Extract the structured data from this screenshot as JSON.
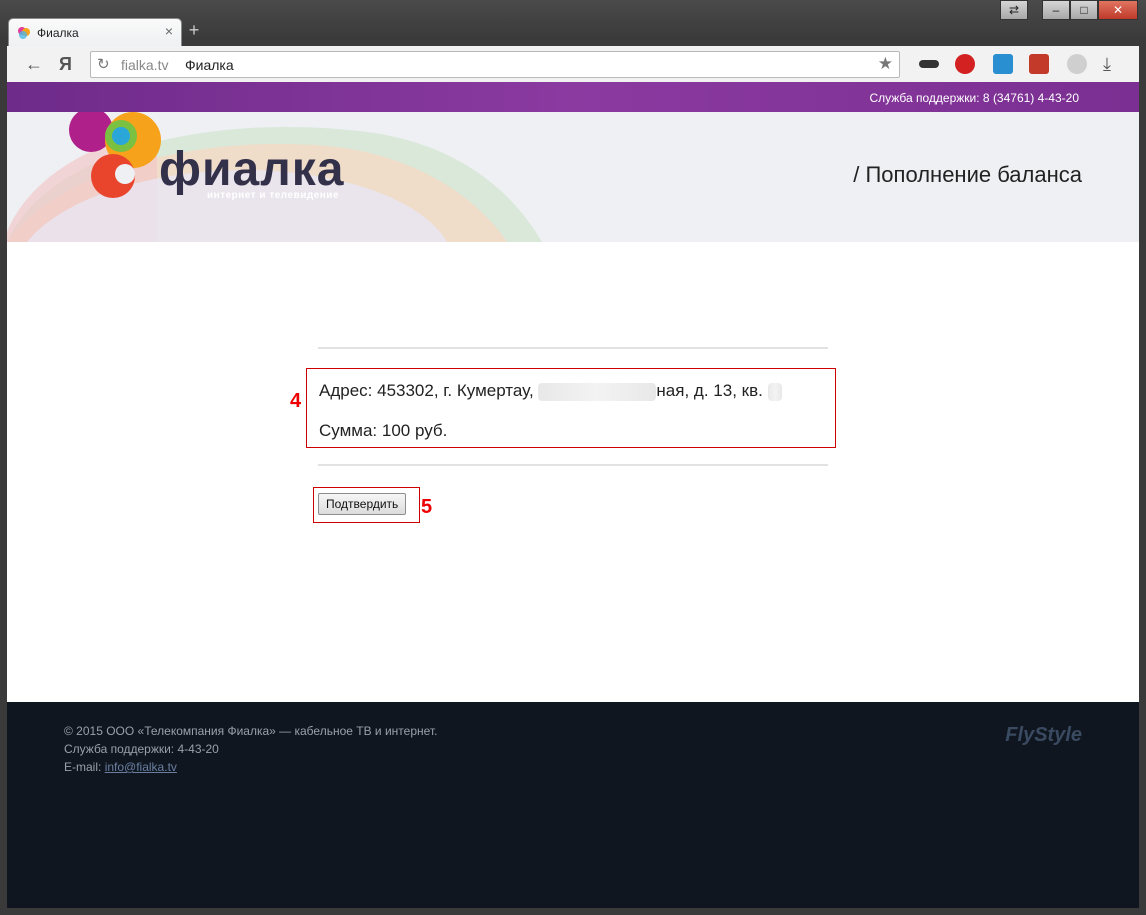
{
  "browser": {
    "tab_title": "Фиалка",
    "new_tab": "+",
    "close_tab": "×",
    "url_domain": "fialka.tv",
    "url_title": "Фиалка",
    "back": "←",
    "yandex": "Я"
  },
  "site": {
    "support_top": "Служба поддержки: 8 (34761) 4-43-20",
    "logo_name": "фиалка",
    "logo_tagline": "интернет и телевидение",
    "page_title": "/ Пополнение баланса"
  },
  "confirm": {
    "address_prefix": "Адрес: 453302, г. Кумертау,",
    "address_suffix": "ная, д. 13, кв.",
    "sum": "Сумма: 100 руб.",
    "marker_4": "4",
    "marker_5": "5",
    "confirm_button": "Подтвердить"
  },
  "footer": {
    "copyright": "© 2015 ООО «Телекомпания Фиалка» — кабельное ТВ и интернет.",
    "support": "Служба поддержки: 4-43-20",
    "email_label": "E-mail:",
    "email": "info@fialka.tv",
    "dev_logo": "FlyStyle"
  }
}
